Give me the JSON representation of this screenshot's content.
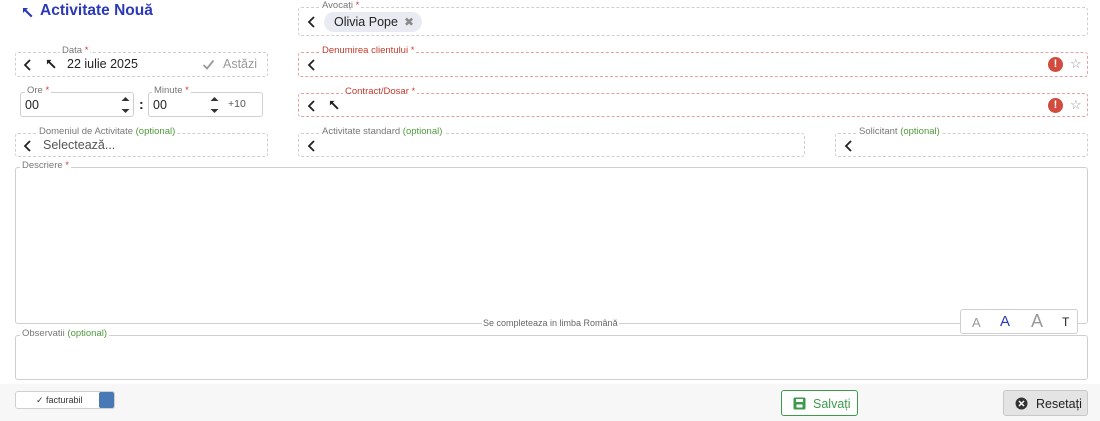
{
  "header": {
    "title": "Activitate Nouă"
  },
  "fields": {
    "lawyers": {
      "label": "Avocați",
      "required_mark": "*",
      "chips": [
        "Olivia Pope"
      ]
    },
    "date": {
      "label": "Data",
      "required_mark": "*",
      "value": "22 iulie 2025",
      "today_label": "Astăzi"
    },
    "client": {
      "label": "Denumirea clientului",
      "required_mark": "*"
    },
    "hours": {
      "label": "Ore",
      "required_mark": "*",
      "value": "00"
    },
    "minutes": {
      "label": "Minute",
      "required_mark": "*",
      "value": "00",
      "plus_label": "+10"
    },
    "time_separator": ":",
    "contract": {
      "label": "Contract/Dosar",
      "required_mark": "*"
    },
    "domain": {
      "label": "Domeniul de Activitate",
      "optional": "(optional)",
      "placeholder": "Selectează..."
    },
    "standard": {
      "label": "Activitate standard",
      "optional": "(optional)"
    },
    "requester": {
      "label": "Solicitant",
      "optional": "(optional)"
    },
    "description": {
      "label": "Descriere",
      "required_mark": "*",
      "hint": "Se completeaza in limba Română"
    },
    "text_size": {
      "small": "A",
      "medium": "A",
      "large": "A",
      "type": "T"
    },
    "observations": {
      "label": "Observatii",
      "optional": "(optional)"
    }
  },
  "footer": {
    "billable_label": "✓ facturabil",
    "save_label": "Salvați",
    "reset_label": "Resetați"
  },
  "colors": {
    "title": "#2b39b8",
    "required": "#d23a3a",
    "optional": "#4f9a3a",
    "error_icon": "#d24b3e",
    "save_green": "#3d9a4b",
    "toggle_blue": "#4a78b5"
  },
  "icons": {
    "title": "pin-icon",
    "back": "chevron-left-icon",
    "pin": "pin-icon",
    "check": "check-icon",
    "error": "exclamation-circle-icon",
    "star": "star-icon",
    "save": "floppy-disk-icon",
    "reset": "times-circle-icon"
  }
}
